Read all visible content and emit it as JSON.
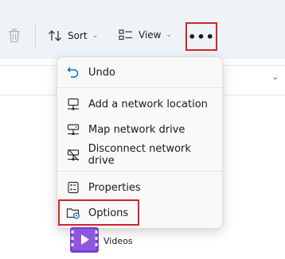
{
  "toolbar": {
    "delete_icon": "trash-icon",
    "sort_label": "Sort",
    "view_label": "View",
    "more_icon": "ellipsis-icon",
    "more_glyph": "•••"
  },
  "menu": {
    "items": [
      {
        "label": "Undo",
        "icon": "undo-icon"
      },
      {
        "label": "Add a network location",
        "icon": "network-location-icon"
      },
      {
        "label": "Map network drive",
        "icon": "map-drive-icon"
      },
      {
        "label": "Disconnect network drive",
        "icon": "disconnect-drive-icon"
      },
      {
        "label": "Properties",
        "icon": "properties-icon"
      },
      {
        "label": "Options",
        "icon": "folder-options-icon"
      }
    ]
  },
  "content": {
    "videos_label": "Videos",
    "videos_icon": "videos-folder-icon"
  },
  "colors": {
    "highlight": "#d5232c",
    "toolbar_bg": "#eef3f8",
    "accent": "#0067c0"
  }
}
